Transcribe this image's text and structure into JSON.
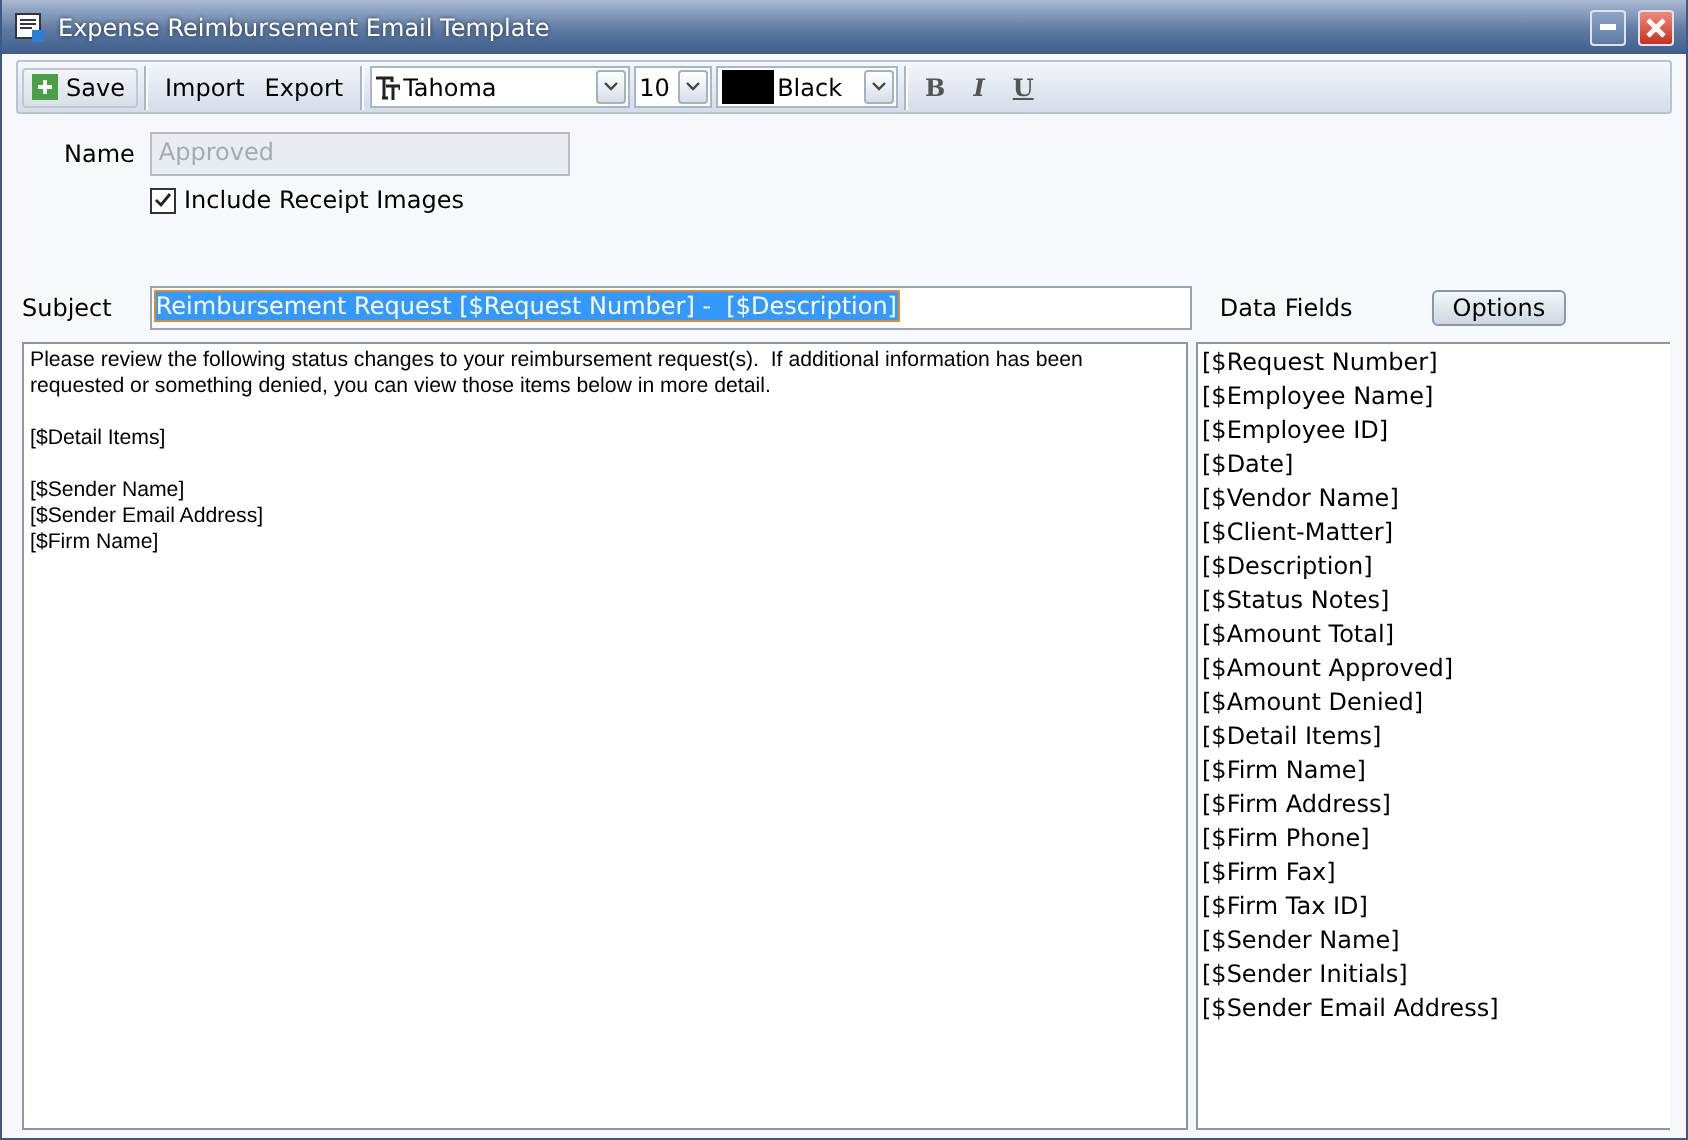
{
  "window": {
    "title": "Expense Reimbursement Email Template"
  },
  "toolbar": {
    "buttons": [
      {
        "label": "Save",
        "kind": "add"
      },
      {
        "label": "Import",
        "kind": "plain"
      },
      {
        "label": "Export",
        "kind": "plain"
      }
    ],
    "font": {
      "value": "Tahoma"
    },
    "size": {
      "value": "10"
    },
    "color": {
      "value": "Black",
      "color": "#000000"
    },
    "format": [
      {
        "label": "B",
        "kind": "bold"
      },
      {
        "label": "I",
        "kind": "italic"
      },
      {
        "label": "U",
        "kind": "underline"
      }
    ]
  },
  "name": {
    "label": "Name",
    "value": "Approved",
    "disabled": true
  },
  "include_receipts": {
    "label": "Include Receipt Images",
    "checked": true
  },
  "subject": {
    "label": "Subject",
    "value": "Reimbursement Request [$Request Number] -  [$Description]",
    "selected": true
  },
  "body": {
    "blocks": [
      {
        "lines": [
          "Please review the following status changes to your reimbursement request(s).  If additional information has been requested or something denied, you can view those items below in more detail."
        ]
      },
      {
        "lines": [
          "[$Detail Items]"
        ]
      },
      {
        "lines": [
          "[$Sender Name]",
          "[$Sender Email Address]",
          "[$Firm Name]"
        ]
      }
    ]
  },
  "data_fields": {
    "label": "Data Fields",
    "options_button": "Options",
    "items": [
      "[$Request Number]",
      "[$Employee Name]",
      "[$Employee ID]",
      "[$Date]",
      "[$Vendor Name]",
      "[$Client-Matter]",
      "[$Description]",
      "[$Status Notes]",
      "[$Amount Total]",
      "[$Amount Approved]",
      "[$Amount Denied]",
      "[$Detail Items]",
      "[$Firm Name]",
      "[$Firm Address]",
      "[$Firm Phone]",
      "[$Firm Fax]",
      "[$Firm Tax ID]",
      "[$Sender Name]",
      "[$Sender Initials]",
      "[$Sender Email Address]"
    ]
  }
}
